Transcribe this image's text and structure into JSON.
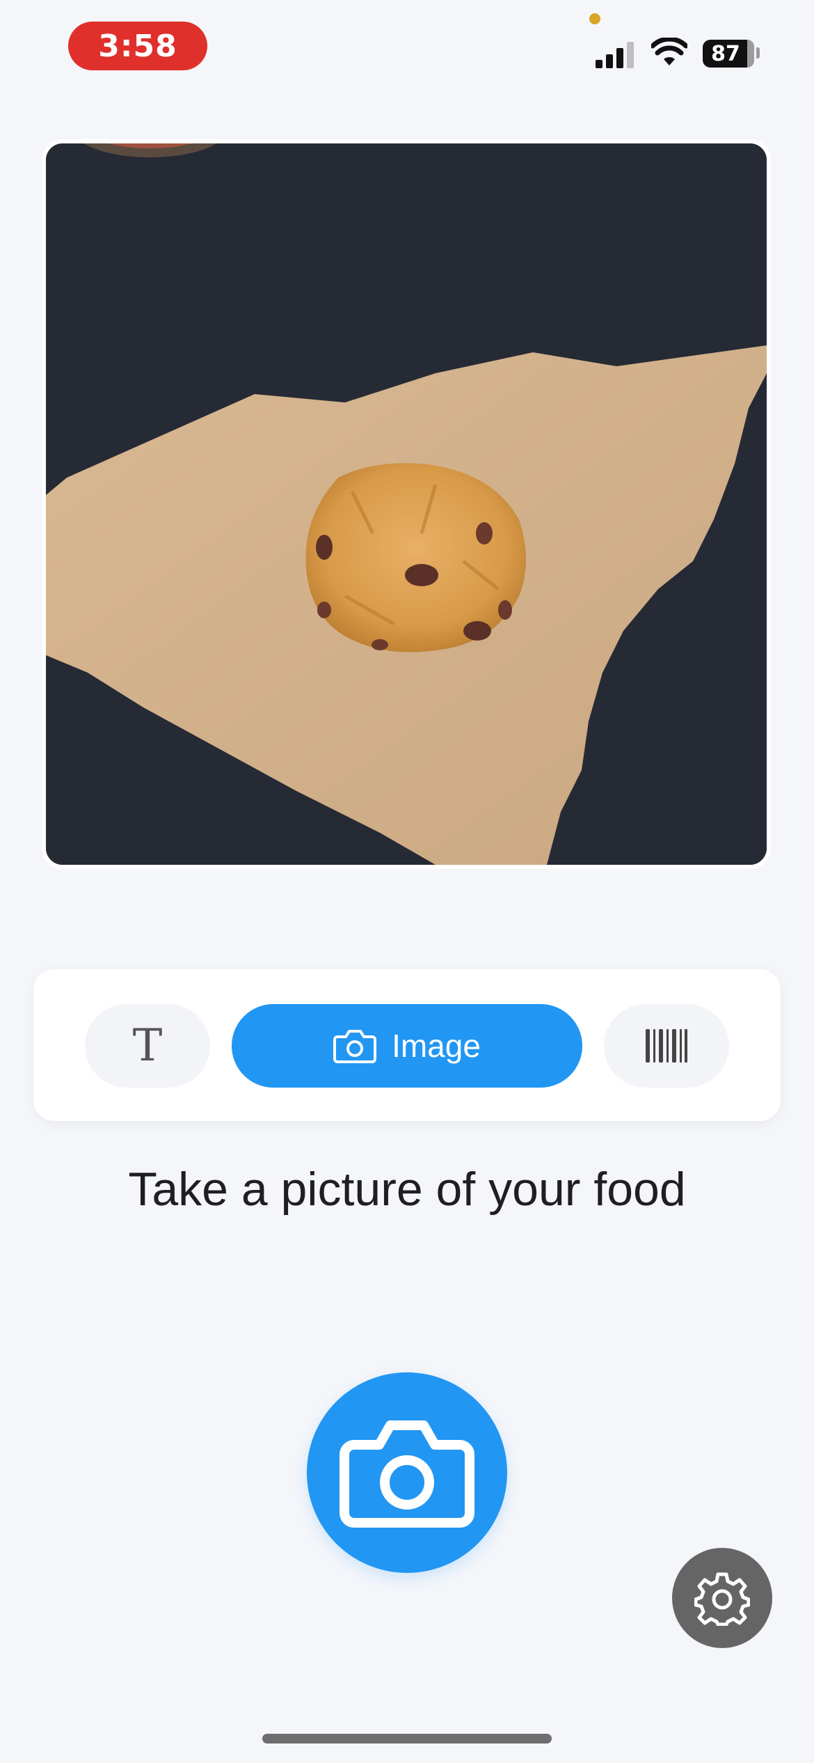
{
  "status_bar": {
    "time": "3:58",
    "battery": "87",
    "icons": [
      "cellular-signal-icon",
      "wifi-icon",
      "battery-icon"
    ]
  },
  "preview": {
    "icons": [
      "camera-preview"
    ]
  },
  "modes": {
    "text_glyph": "T",
    "image_label": "Image",
    "selected": "Image",
    "icons": [
      "text-icon",
      "camera-icon",
      "barcode-icon"
    ]
  },
  "instruction": "Take a picture of your food",
  "controls": {
    "icons": [
      "camera-icon",
      "gear-icon"
    ]
  },
  "colors": {
    "accent": "#2196F3",
    "background": "#F4F6FA",
    "recording_pill": "#E0302B",
    "settings_button": "#656565"
  }
}
